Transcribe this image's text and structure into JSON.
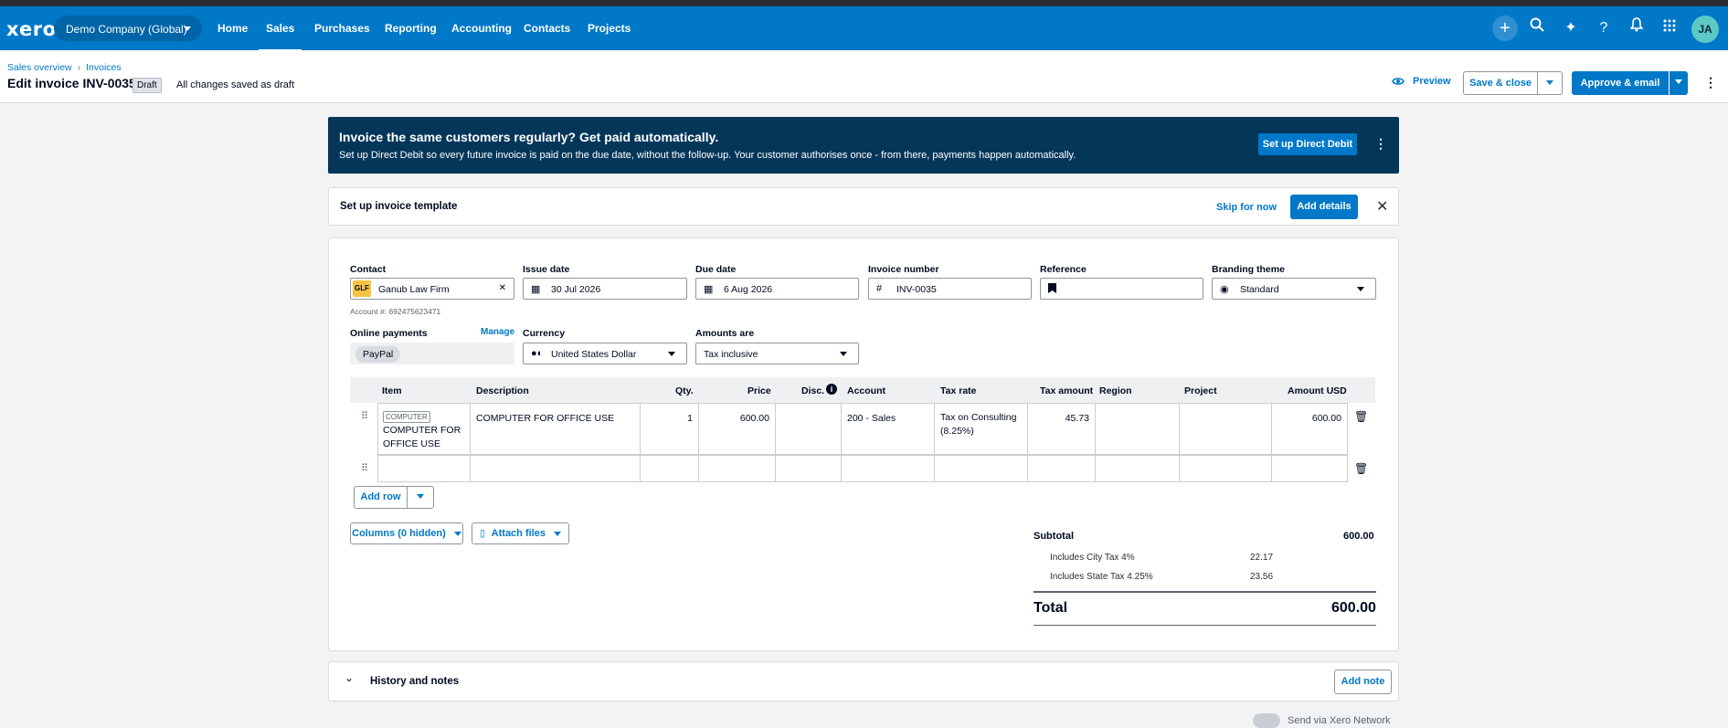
{
  "nav": {
    "logo": "xero",
    "org": "Demo Company (Global)",
    "items": [
      "Home",
      "Sales",
      "Purchases",
      "Reporting",
      "Accounting",
      "Contacts",
      "Projects"
    ],
    "active": "Sales",
    "avatar": "JA",
    "icons": [
      "plus-icon",
      "search-icon",
      "sparkle-icon",
      "help-icon",
      "bell-icon",
      "apps-grid-icon"
    ]
  },
  "header": {
    "breadcrumb": [
      "Sales overview",
      "Invoices"
    ],
    "title": "Edit invoice INV-0035",
    "badge": "Draft",
    "saved_status": "All changes saved as draft",
    "preview": "Preview",
    "save_close": "Save & close",
    "approve_email": "Approve & email"
  },
  "banner": {
    "heading": "Invoice the same customers regularly? Get paid automatically.",
    "body": "Set up Direct Debit so every future invoice is paid on the due date, without the follow-up. Your customer authorises once - from there, payments happen automatically.",
    "button": "Set up Direct Debit"
  },
  "template": {
    "title": "Set up invoice template",
    "skip": "Skip for now",
    "add": "Add details"
  },
  "form": {
    "contact_label": "Contact",
    "contact_badge": "GLF",
    "contact_value": "Ganub Law Firm",
    "account_note": "Account #: 692475623471",
    "issue_label": "Issue date",
    "issue_value": "30 Jul 2026",
    "due_label": "Due date",
    "due_value": "6 Aug 2026",
    "invno_label": "Invoice number",
    "invno_value": "INV-0035",
    "ref_label": "Reference",
    "ref_value": "",
    "brand_label": "Branding theme",
    "brand_value": "Standard",
    "online_label": "Online payments",
    "manage": "Manage",
    "paypal": "PayPal",
    "currency_label": "Currency",
    "currency_value": "United States Dollar",
    "amounts_label": "Amounts are",
    "amounts_value": "Tax inclusive"
  },
  "table": {
    "headers": [
      "Item",
      "Description",
      "Qty.",
      "Price",
      "Disc.",
      "Account",
      "Tax rate",
      "Tax amount",
      "Region",
      "Project",
      "Amount USD"
    ],
    "row": {
      "item_code": "COMPUTER",
      "item_name": "COMPUTER FOR OFFICE USE",
      "description": "COMPUTER FOR OFFICE USE",
      "qty": "1",
      "price": "600.00",
      "disc": "",
      "account": "200 - Sales",
      "tax_rate": "Tax on Consulting (8.25%)",
      "tax_amount": "45.73",
      "region": "",
      "project": "",
      "amount": "600.00"
    },
    "add_row": "Add row",
    "columns": "Columns (0 hidden)",
    "attach": "Attach files"
  },
  "totals": {
    "subtotal_label": "Subtotal",
    "subtotal": "600.00",
    "city_label": "Includes City Tax 4%",
    "city": "22.17",
    "state_label": "Includes State Tax 4.25%",
    "state": "23.56",
    "total_label": "Total",
    "total": "600.00"
  },
  "history": {
    "title": "History and notes",
    "add_note": "Add note"
  },
  "network": "Send via Xero Network"
}
